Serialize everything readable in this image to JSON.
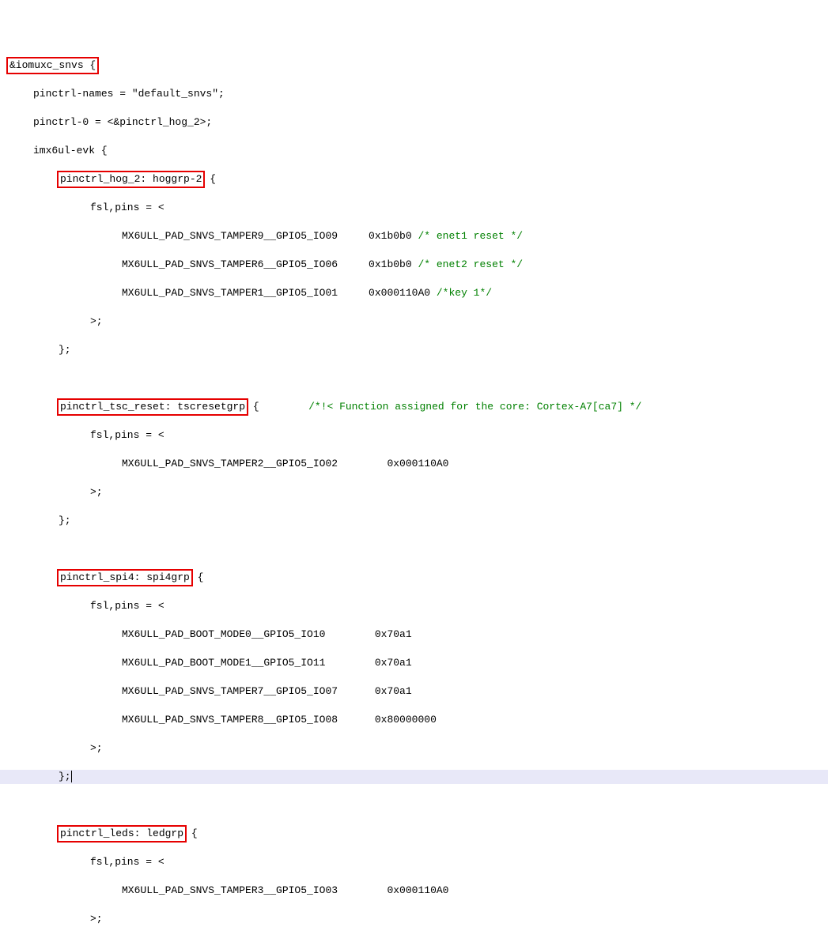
{
  "l1_a": "&iomuxc_snvs {",
  "l2": "pinctrl-names = \"default_snvs\";",
  "l3": "pinctrl-0 = <&pinctrl_hog_2>;",
  "l4": "imx6ul-evk {",
  "l5_a": "pinctrl_hog_2: hoggrp-2",
  "l5_b": " {",
  "l6": "fsl,pins = <",
  "l7_a": "MX6ULL_PAD_SNVS_TAMPER9__GPIO5_IO09     0x1b0b0 ",
  "l7_b": "/* enet1 reset */",
  "l8_a": "MX6ULL_PAD_SNVS_TAMPER6__GPIO5_IO06     0x1b0b0 ",
  "l8_b": "/* enet2 reset */",
  "l9_a": "MX6ULL_PAD_SNVS_TAMPER1__GPIO5_IO01     0x000110A0 ",
  "l9_b": "/*key 1*/",
  "l10": ">;",
  "l11": "};",
  "l12": "",
  "l13_a": "pinctrl_tsc_reset: tscresetgrp",
  "l13_b": " {        ",
  "l13_c": "/*!< Function assigned for the core: Cortex-A7[ca7] */",
  "l14": "fsl,pins = <",
  "l15": "MX6ULL_PAD_SNVS_TAMPER2__GPIO5_IO02        0x000110A0",
  "l16": ">;",
  "l17": "};",
  "l18": "",
  "l19_a": "pinctrl_spi4: spi4grp",
  "l19_b": " {",
  "l20": "fsl,pins = <",
  "l21": "MX6ULL_PAD_BOOT_MODE0__GPIO5_IO10        0x70a1",
  "l22": "MX6ULL_PAD_BOOT_MODE1__GPIO5_IO11        0x70a1",
  "l23": "MX6ULL_PAD_SNVS_TAMPER7__GPIO5_IO07      0x70a1",
  "l24": "MX6ULL_PAD_SNVS_TAMPER8__GPIO5_IO08      0x80000000",
  "l25": ">;",
  "l26": "};",
  "l27": "",
  "l28_a": "pinctrl_leds: ledgrp",
  "l28_b": " {",
  "l29": "fsl,pins = <",
  "l30": "MX6ULL_PAD_SNVS_TAMPER3__GPIO5_IO03        0x000110A0",
  "l31": ">;"
}
